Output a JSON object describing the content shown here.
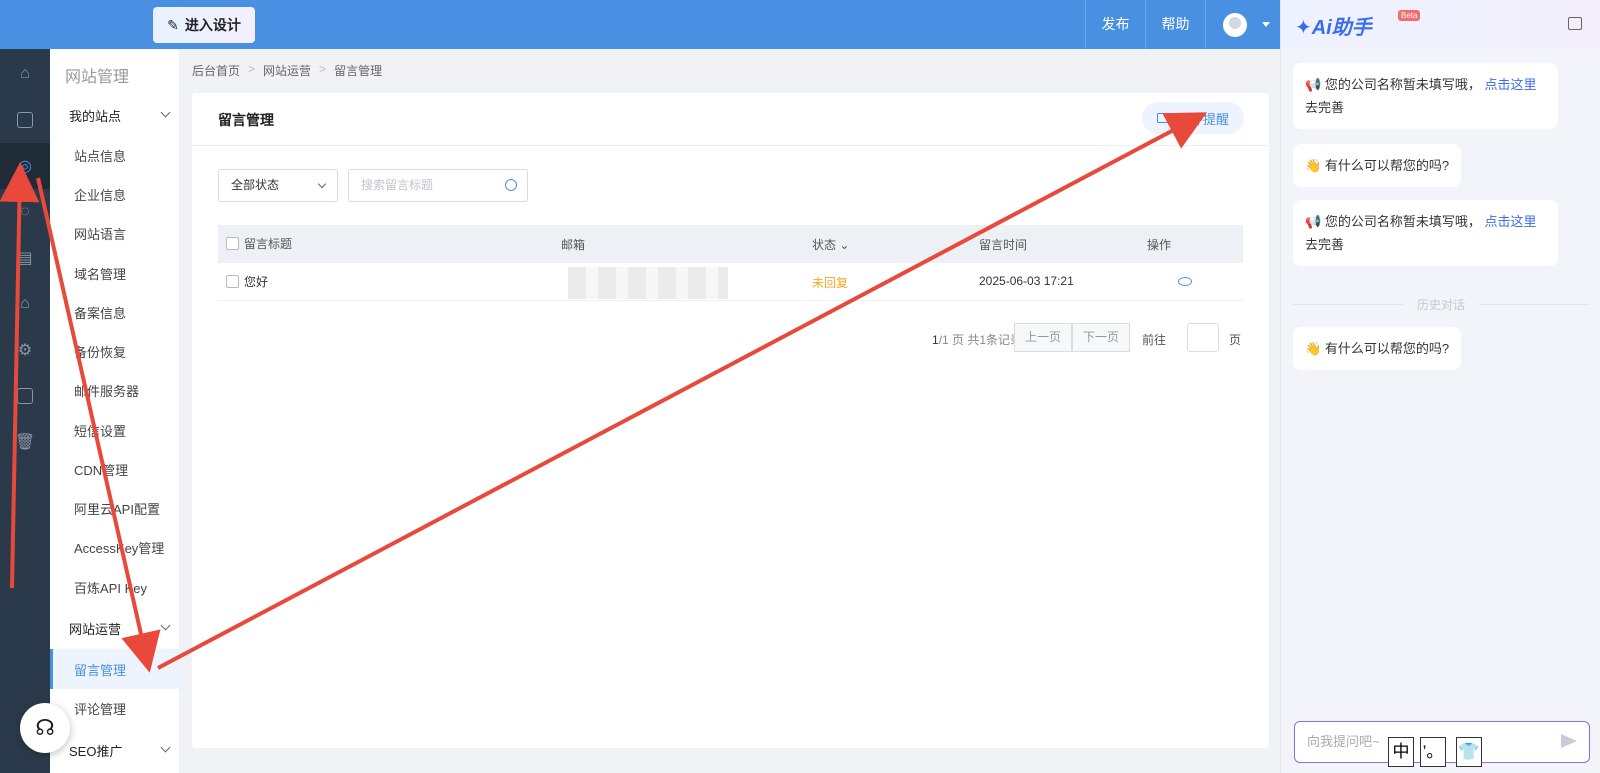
{
  "topbar": {
    "design_button": "进入设计",
    "publish": "发布",
    "help": "帮助"
  },
  "subnav": {
    "title": "网站管理",
    "group_my_site": "我的站点",
    "items": [
      "站点信息",
      "企业信息",
      "网站语言",
      "域名管理",
      "备案信息",
      "备份恢复",
      "邮件服务器",
      "短信设置",
      "CDN管理",
      "阿里云API配置",
      "AccessKey管理",
      "百炼API Key"
    ],
    "group_operation": "网站运营",
    "operation_items": [
      "留言管理",
      "评论管理"
    ],
    "group_seo": "SEO推广"
  },
  "breadcrumb": [
    "后台首页",
    "网站运营",
    "留言管理"
  ],
  "page": {
    "title": "留言管理",
    "mail_reminder": "邮件提醒",
    "status_filter": "全部状态",
    "search_placeholder": "搜索留言标题"
  },
  "table": {
    "headers": [
      "留言标题",
      "邮箱",
      "状态",
      "留言时间",
      "操作"
    ],
    "rows": [
      {
        "title": "您好",
        "email": "",
        "status": "未回复",
        "time": "2025-06-03 17:21"
      }
    ]
  },
  "pager": {
    "current": "1",
    "info": "/1 页 共1条记录",
    "prev": "上一页",
    "next": "下一页",
    "goto": "前往",
    "page": "页"
  },
  "ai": {
    "logo": "Ai助手",
    "beta": "Beta",
    "msg1_text": "您的公司名称暂未填写哦，",
    "msg1_link": "点击这里",
    "msg1_tail": "去完善",
    "msg2": "有什么可以帮您的吗?",
    "history": "历史对话",
    "input_placeholder": "向我提问吧~"
  },
  "ime": [
    "中",
    "’。",
    "👕"
  ],
  "colors": {
    "primary": "#4a90e2",
    "rail": "#2b3a4a",
    "status_unreplied": "#f5a623",
    "annotation": "#e8493b"
  }
}
